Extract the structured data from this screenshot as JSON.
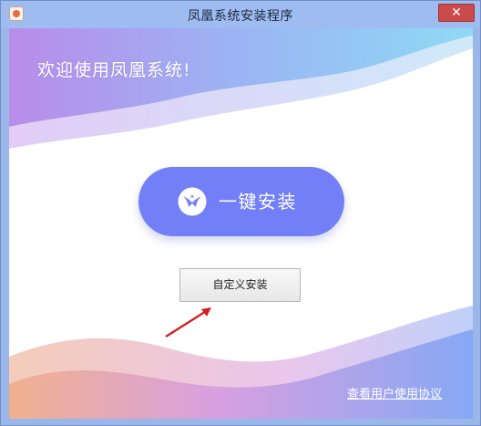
{
  "window": {
    "title": "凤凰系统安装程序",
    "close_symbol": "✕"
  },
  "hero": {
    "welcome_text": "欢迎使用凤凰系统!"
  },
  "actions": {
    "one_click_install": "一键安装",
    "custom_install": "自定义安装"
  },
  "footer": {
    "user_agreement": "查看用户使用协议"
  },
  "icons": {
    "app": "phoenix-app-icon",
    "button": "phoenix-logo-icon",
    "pointer": "red-arrow-icon",
    "close": "close-icon"
  },
  "colors": {
    "primary_button": "#727ff6",
    "title_bar": "#9fbcf0",
    "close_button": "#c94b4b",
    "annotation_arrow": "#d11f1f"
  }
}
